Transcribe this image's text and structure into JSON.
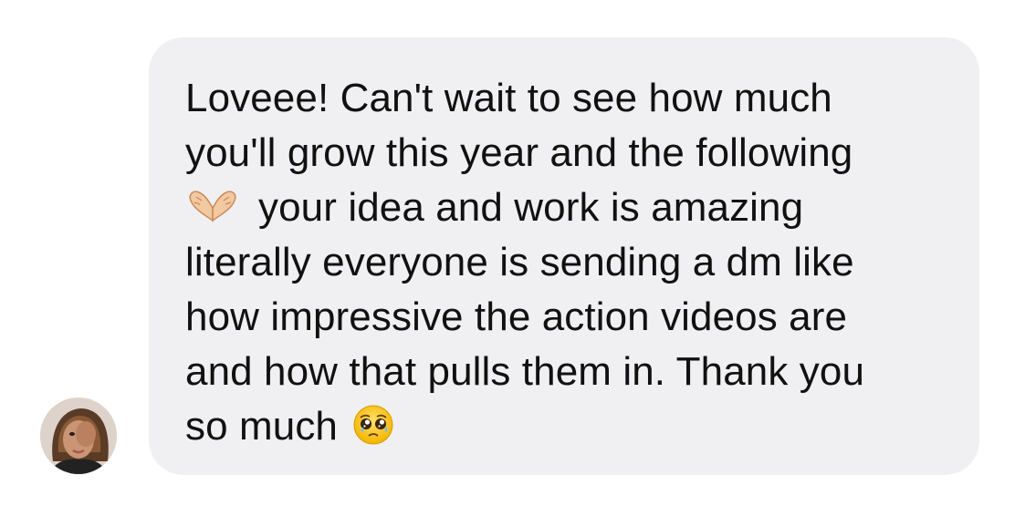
{
  "conversation": {
    "sender_avatar_icon": "avatar-photo",
    "message": {
      "line_1": "Loveee! Can't wait to see how much",
      "line_2": "you'll grow this year and the following",
      "line_3_emoji": "heart-hands-icon",
      "line_3": "your idea and work is amazing",
      "line_4": "literally everyone is sending a dm like",
      "line_5": "how impressive the action videos are",
      "line_6": "and how that pulls them in. Thank you",
      "line_7": "so much",
      "line_7_emoji": "pleading-face-icon"
    }
  },
  "colors": {
    "bubble_background": "#f0f0f2",
    "message_text": "#111111",
    "page_background": "#ffffff"
  }
}
